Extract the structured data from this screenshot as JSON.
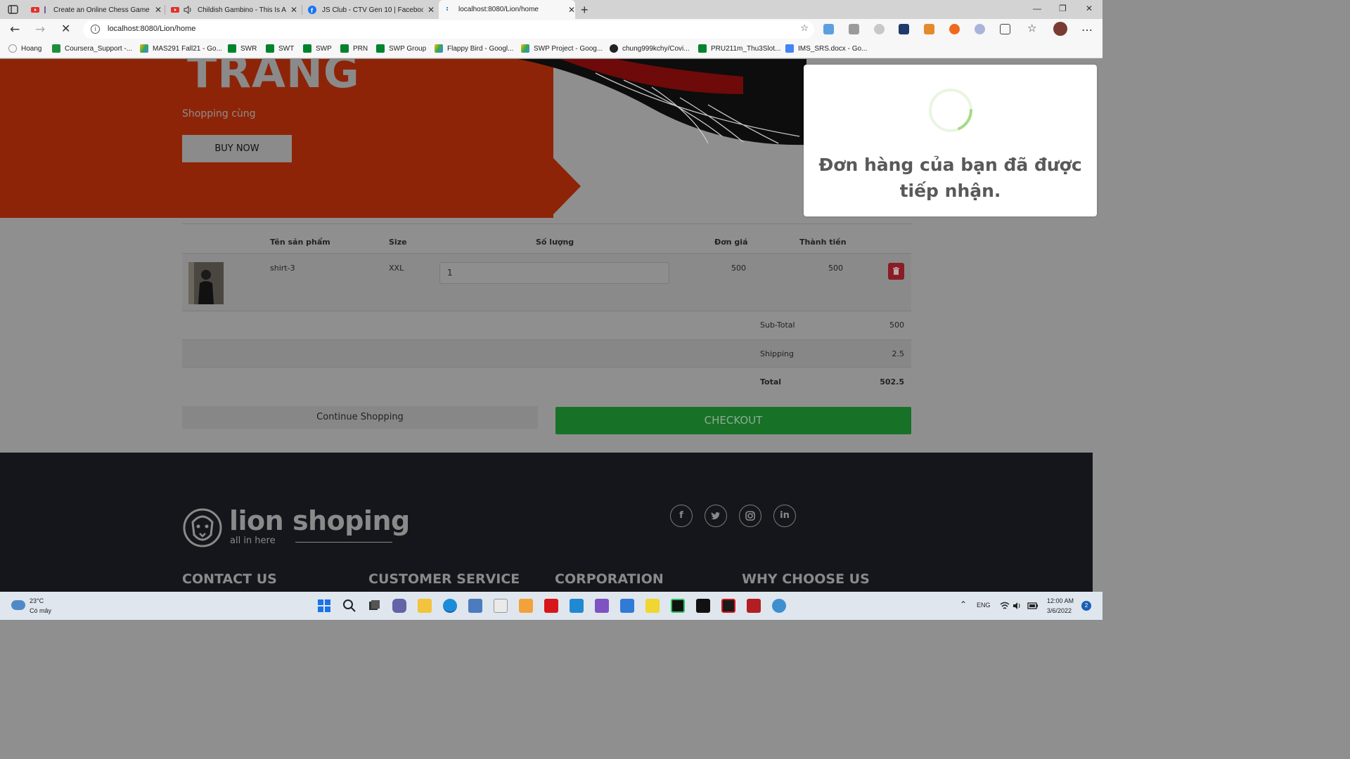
{
  "browser": {
    "tabs": [
      {
        "title": "Create an Online Chess Game",
        "favicon": "youtube-icon"
      },
      {
        "title": "Childish Gambino - This Is A",
        "favicon": "youtube-icon"
      },
      {
        "title": "JS Club - CTV Gen 10 | Facebook",
        "favicon": "facebook-icon"
      },
      {
        "title": "localhost:8080/Lion/home",
        "favicon": "loading-icon",
        "active": true
      }
    ],
    "new_tab": "+",
    "url": "localhost:8080/Lion/home",
    "bookmarks": [
      "Hoang",
      "Coursera_Support -...",
      "MAS291 Fall21 - Go...",
      "SWR",
      "SWT",
      "SWP",
      "PRN",
      "SWP Group",
      "Flappy Bird - Googl...",
      "SWP Project - Goog...",
      "chung999kchy/Covi...",
      "PRU211m_Thu3Slot...",
      "IMS_SRS.docx - Go..."
    ]
  },
  "hero": {
    "title": "TRANG",
    "subtitle": "Shopping cùng",
    "buy_button": "BUY NOW"
  },
  "cart": {
    "headers": {
      "product": "Tên sản phẩm",
      "size": "Size",
      "quantity": "Số lượng",
      "unit_price": "Đơn giá",
      "total": "Thành tiền"
    },
    "items": [
      {
        "name": "shirt-3",
        "size": "XXL",
        "quantity": "1",
        "unit_price": "500",
        "total": "500"
      }
    ],
    "summary": {
      "subtotal_label": "Sub-Total",
      "subtotal_value": "500",
      "shipping_label": "Shipping",
      "shipping_value": "2.5",
      "total_label": "Total",
      "total_value": "502.5"
    },
    "continue_button": "Continue Shopping",
    "checkout_button": "CHECKOUT"
  },
  "footer": {
    "logo_name": "lion shoping",
    "logo_tagline": "all in here",
    "social": [
      "f",
      "t",
      "ig",
      "in"
    ],
    "columns": [
      "CONTACT US",
      "CUSTOMER SERVICE",
      "CORPORATION",
      "WHY CHOOSE US"
    ]
  },
  "alert": {
    "message": "Đơn hàng của bạn đã được tiếp nhận.",
    "spinner_color": "#a5dc86"
  },
  "taskbar": {
    "temperature": "23°C",
    "weather": "Có mây",
    "language": "ENG",
    "time": "12:00 AM",
    "date": "3/6/2022",
    "notifications": "2"
  },
  "colors": {
    "hero_red": "#8e2407",
    "checkout_green": "#177127",
    "delete_red": "#8a1c25",
    "footer_dark": "#15161b"
  }
}
